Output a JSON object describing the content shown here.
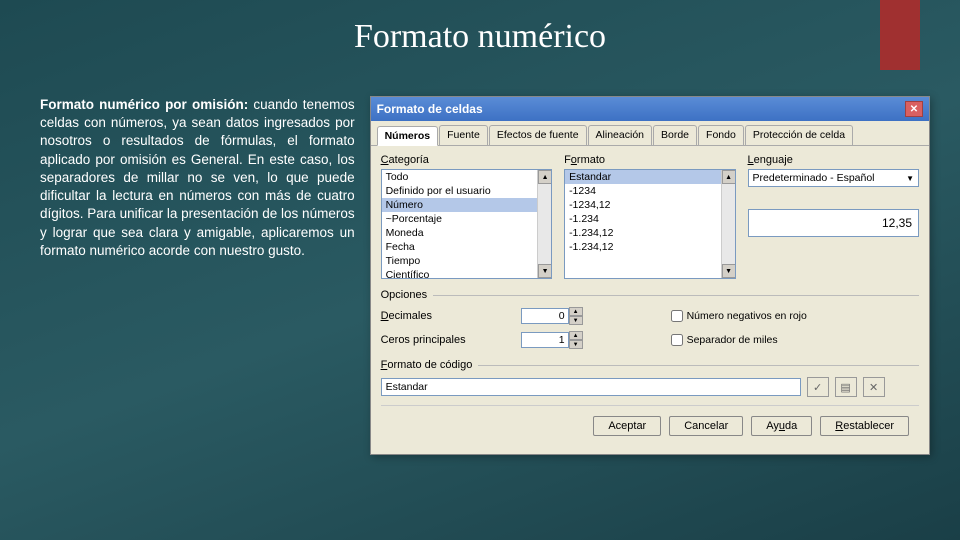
{
  "slide": {
    "title": "Formato numérico",
    "desc_bold": "Formato numérico por omisión:",
    "desc_rest": " cuando tenemos celdas con números, ya sean datos ingresados por nosotros o resultados de fórmulas, el formato aplicado por omisión es General. En este caso, los separadores de millar no se ven, lo que puede dificultar la lectura en números con más de cuatro dígitos. Para unificar la presentación de los números y lograr que sea clara y amigable, aplicaremos un formato numérico acorde con nuestro gusto."
  },
  "dialog": {
    "title": "Formato de celdas",
    "tabs": [
      "Números",
      "Fuente",
      "Efectos de fuente",
      "Alineación",
      "Borde",
      "Fondo",
      "Protección de celda"
    ],
    "active_tab": 0,
    "labels": {
      "categoria": "Categoría",
      "formato": "Formato",
      "lenguaje": "Lenguaje",
      "opciones": "Opciones",
      "decimales": "Decimales",
      "ceros": "Ceros principales",
      "neg_rojo": "Número negativos en rojo",
      "sep_miles": "Separador de miles",
      "formato_codigo": "Formato de código"
    },
    "categoria_items": [
      "Todo",
      "Definido por el usuario",
      "Número",
      "~Porcentaje",
      "Moneda",
      "Fecha",
      "Tiempo",
      "Científico"
    ],
    "categoria_sel": 2,
    "formato_items": [
      "Estandar",
      "-1234",
      "-1234,12",
      "-1.234",
      "-1.234,12",
      "-1.234,12"
    ],
    "formato_sel": 0,
    "lenguaje_value": "Predeterminado - Español",
    "preview": "12,35",
    "decimales_value": "0",
    "ceros_value": "1",
    "codigo_value": "Estandar",
    "buttons": {
      "aceptar": "Aceptar",
      "cancelar": "Cancelar",
      "ayuda": "Ayuda",
      "restablecer": "Restablecer"
    }
  }
}
